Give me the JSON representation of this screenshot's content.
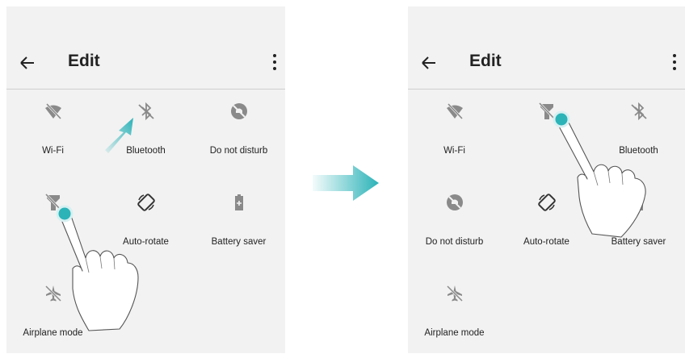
{
  "screens": [
    {
      "title": "Edit",
      "tiles": [
        {
          "label": "Wi-Fi",
          "icon": "wifi-off-icon"
        },
        {
          "label": "Bluetooth",
          "icon": "bluetooth-off-icon"
        },
        {
          "label": "Do not disturb",
          "icon": "do-not-disturb-icon"
        },
        {
          "label": "",
          "icon": "flashlight-icon"
        },
        {
          "label": "Auto-rotate",
          "icon": "auto-rotate-icon"
        },
        {
          "label": "Battery saver",
          "icon": "battery-saver-icon"
        },
        {
          "label": "Airplane mode",
          "icon": "airplane-mode-icon"
        }
      ]
    },
    {
      "title": "Edit",
      "tiles": [
        {
          "label": "Wi-Fi",
          "icon": "wifi-off-icon"
        },
        {
          "label": "",
          "icon": "flashlight-icon"
        },
        {
          "label": "Bluetooth",
          "icon": "bluetooth-off-icon"
        },
        {
          "label": "Do not disturb",
          "icon": "do-not-disturb-icon"
        },
        {
          "label": "Auto-rotate",
          "icon": "auto-rotate-icon"
        },
        {
          "label": "Battery saver",
          "icon": "battery-saver-icon"
        },
        {
          "label": "Airplane mode",
          "icon": "airplane-mode-icon"
        }
      ]
    }
  ],
  "colors": {
    "accent": "#2bb3b8",
    "icon": "#8a8a8a",
    "background": "#f2f2f2"
  }
}
